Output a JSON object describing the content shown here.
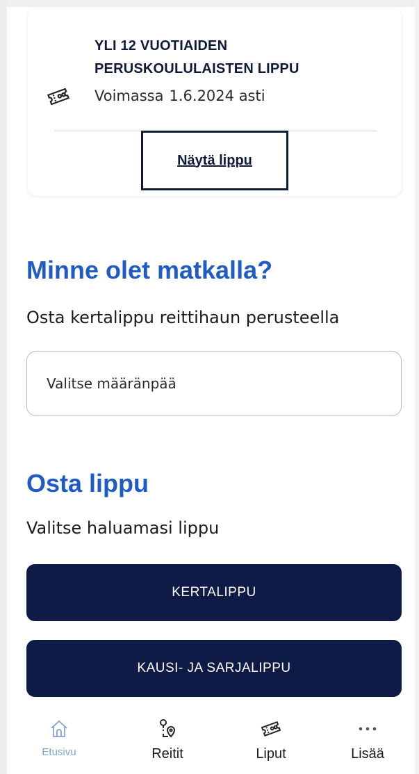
{
  "ticket": {
    "title_line1": "YLI 12 VUOTIAIDEN",
    "title_line2": "PERUSKOULULAISTEN LIPPU",
    "valid_label": "Voimassa",
    "valid_date": "1.6.2024 asti",
    "show_button": "Näytä lippu",
    "icon": "ticket-icon"
  },
  "destination": {
    "heading": "Minne olet matkalla?",
    "subtext": "Osta kertalippu reittihaun perusteella",
    "input_value": "Valitse määränpää"
  },
  "buy": {
    "heading": "Osta lippu",
    "subtext": "Valitse haluamasi lippu",
    "single_ticket": "KERTALIPPU",
    "season_ticket": "KAUSI- JA SARJALIPPU"
  },
  "tabbar": {
    "items": [
      {
        "label": "Etusivu",
        "icon": "home-icon",
        "active": true
      },
      {
        "label": "Reitit",
        "icon": "route-icon",
        "active": false
      },
      {
        "label": "Liput",
        "icon": "ticket-icon",
        "active": false
      },
      {
        "label": "Lisää",
        "icon": "more-icon",
        "active": false
      }
    ]
  },
  "colors": {
    "accent": "#1f5bc4",
    "navy": "#0d1b46",
    "active_tab": "#7fa3d6"
  }
}
